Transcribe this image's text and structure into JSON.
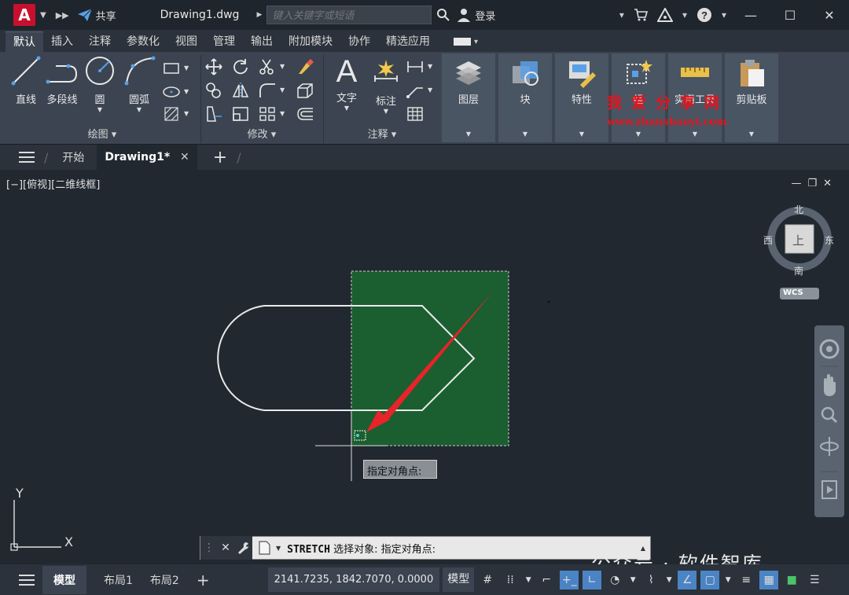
{
  "app": {
    "logo_letter": "A",
    "share_label": "共享",
    "document_title": "Drawing1.dwg",
    "search_placeholder": "键入关键字或短语",
    "login_label": "登录"
  },
  "ribbon_tabs": [
    "默认",
    "插入",
    "注释",
    "参数化",
    "视图",
    "管理",
    "输出",
    "附加模块",
    "协作",
    "精选应用"
  ],
  "ribbon": {
    "draw": {
      "title": "绘图",
      "line": "直线",
      "polyline": "多段线",
      "circle": "圆",
      "arc": "圆弧"
    },
    "modify": {
      "title": "修改"
    },
    "annotation": {
      "title": "注释",
      "text": "文字",
      "dimension": "标注"
    },
    "layers": "图层",
    "block": "块",
    "properties": "特性",
    "groups": "组",
    "utilities": "实用工具",
    "clipboard": "剪贴板"
  },
  "watermark": {
    "line1": "我爱分享网",
    "line2": "www.zhanshaoyi.com"
  },
  "doc_tabs": {
    "start": "开始",
    "active": "Drawing1*"
  },
  "viewport": {
    "label": "[−][俯视][二维线框]",
    "viewcube": {
      "north": "北",
      "south": "南",
      "east": "东",
      "west": "西",
      "top": "上",
      "wcs": "WCS"
    },
    "tooltip": "指定对角点:",
    "ucs_x": "X",
    "ucs_y": "Y"
  },
  "command_line": {
    "command": "STRETCH",
    "prompt": "选择对象:  指定对角点:"
  },
  "status_bar": {
    "model_tab": "模型",
    "layout1": "布局1",
    "layout2": "布局2",
    "coordinates": "2141.7235, 1842.7070, 0.0000",
    "mode": "模型"
  },
  "footer_watermark": "公众号 · 软件智库",
  "colors": {
    "selection_fill": "#1b5e2f",
    "arrow": "#e8232a",
    "accent": "#4a84c4"
  }
}
